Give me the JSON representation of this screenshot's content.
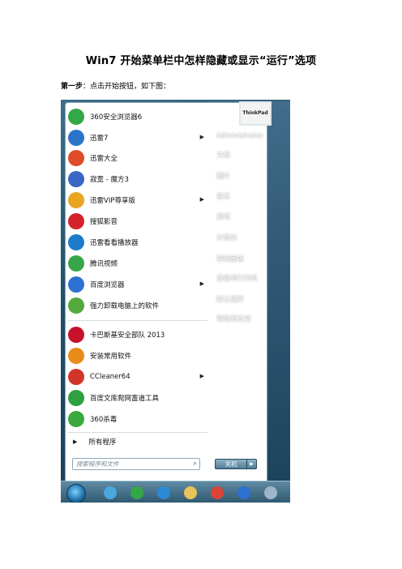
{
  "doc": {
    "title": "Win7 开始菜单栏中怎样隐藏或显示“运行”选项",
    "step_label": "第一步",
    "step_text": "：点击开始按钮，如下图："
  },
  "start_menu": {
    "programs": [
      {
        "label": "360安全浏览器6",
        "icon": "browser-360-icon",
        "color": "#33a846",
        "has_arrow": false
      },
      {
        "label": "迅雷7",
        "icon": "xunlei-bird-icon",
        "color": "#2b74c9",
        "has_arrow": true
      },
      {
        "label": "迅雷大全",
        "icon": "xunlei-all-icon",
        "color": "#e04b2a",
        "has_arrow": false
      },
      {
        "label": "寂寞 - 魔方3",
        "icon": "mofang-icon",
        "color": "#3a66c5",
        "has_arrow": false
      },
      {
        "label": "迅雷VIP尊享版",
        "icon": "xunlei-vip-icon",
        "color": "#e8a520",
        "has_arrow": true
      },
      {
        "label": "搜狐影音",
        "icon": "sohu-video-icon",
        "color": "#d5222a",
        "has_arrow": false
      },
      {
        "label": "迅雷看看播放器",
        "icon": "xunlei-kankan-icon",
        "color": "#1d7cc9",
        "has_arrow": false
      },
      {
        "label": "腾讯视频",
        "icon": "tencent-video-icon",
        "color": "#38a54a",
        "has_arrow": false
      },
      {
        "label": "百度浏览器",
        "icon": "baidu-browser-icon",
        "color": "#2d72d2",
        "has_arrow": true
      },
      {
        "label": "强力卸载电脑上的软件",
        "icon": "uninstall-icon",
        "color": "#54a93b",
        "has_arrow": false
      },
      {
        "label": "卡巴斯基安全部队 2013",
        "icon": "kaspersky-icon",
        "color": "#c7112d",
        "has_arrow": false
      },
      {
        "label": "安装常用软件",
        "icon": "windows-flag-icon",
        "color": "#e88b19",
        "has_arrow": false
      },
      {
        "label": "CCleaner64",
        "icon": "ccleaner-icon",
        "color": "#d2362a",
        "has_arrow": true
      },
      {
        "label": "百度文库爬网富道工具",
        "icon": "baidu-wenku-icon",
        "color": "#2ea041",
        "has_arrow": false
      },
      {
        "label": "360杀毒",
        "icon": "antivirus-360-icon",
        "color": "#3ba83f",
        "has_arrow": false
      }
    ],
    "all_programs": "所有程序",
    "search_placeholder": "搜索程序和文件",
    "user_picture_text": "ThinkPad",
    "right_items": [
      {
        "label": "Administrator"
      },
      {
        "label": "文档"
      },
      {
        "label": "图片"
      },
      {
        "label": "音乐"
      },
      {
        "label": "游戏"
      },
      {
        "label": "计算机"
      },
      {
        "label": "控制面板"
      },
      {
        "label": "设备和打印机"
      },
      {
        "label": "默认程序"
      },
      {
        "label": "帮助和支持"
      }
    ],
    "shutdown_label": "关机"
  },
  "taskbar": {
    "buttons": [
      {
        "icon": "windows-start-orb-icon",
        "color": "#1d6ea8"
      },
      {
        "icon": "snail-app-icon",
        "color": "#4aa7df"
      },
      {
        "icon": "browser-360-icon",
        "color": "#33a846"
      },
      {
        "icon": "internet-explorer-icon",
        "color": "#2b8ad8"
      },
      {
        "icon": "folder-icon",
        "color": "#e8c35a"
      },
      {
        "icon": "chrome-icon",
        "color": "#db4437"
      },
      {
        "icon": "baidu-browser-icon",
        "color": "#2d72d2"
      },
      {
        "icon": "app-icon",
        "color": "#9bb7c8"
      }
    ]
  }
}
